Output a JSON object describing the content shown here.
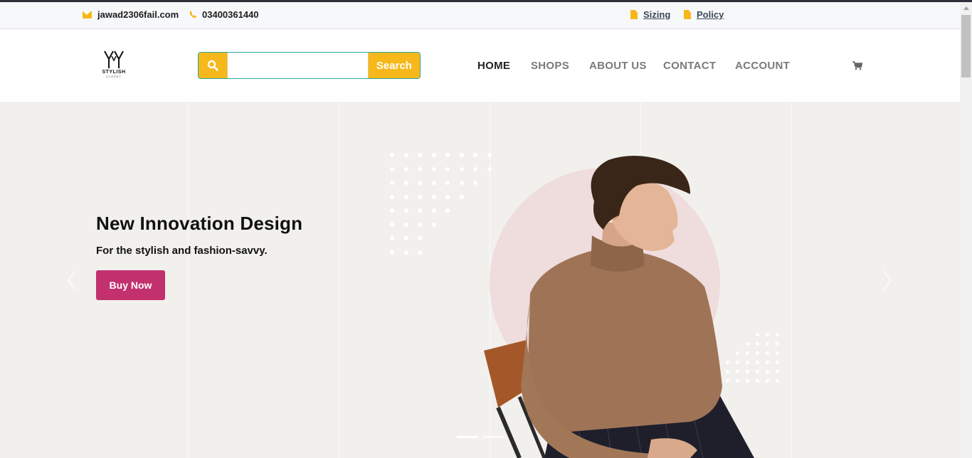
{
  "topbar": {
    "email": "jawad2306fail.com",
    "phone": "03400361440",
    "links": [
      {
        "label": "Sizing",
        "icon": "document-icon"
      },
      {
        "label": "Policy",
        "icon": "document-icon"
      }
    ]
  },
  "logo": {
    "text": "STYLISH",
    "sub": "CLOSET"
  },
  "search": {
    "placeholder": "",
    "value": "",
    "button": "Search"
  },
  "nav": {
    "items": [
      {
        "label": "HOME",
        "active": true
      },
      {
        "label": "SHOPS",
        "active": false
      },
      {
        "label": "ABOUT US",
        "active": false
      },
      {
        "label": "CONTACT",
        "active": false
      },
      {
        "label": "ACCOUNT",
        "active": false
      }
    ]
  },
  "hero": {
    "title": "New Innovation Design",
    "subtitle": "For the stylish and fashion-savvy.",
    "button": "Buy Now",
    "slides": 2,
    "active_slide": 1
  },
  "colors": {
    "accent_yellow": "#f6b81a",
    "buy_button": "#c3306e",
    "hero_bg": "#f2f0ed",
    "circle": "#efdcdc"
  }
}
